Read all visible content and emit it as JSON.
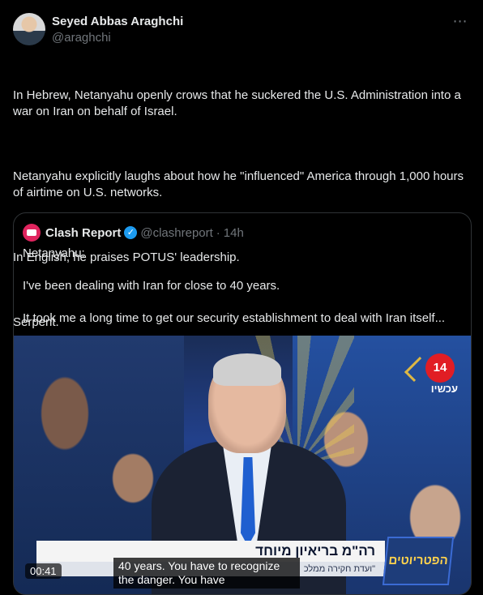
{
  "author": {
    "name": "Seyed Abbas Araghchi",
    "handle": "@araghchi",
    "more_icon": "more-icon"
  },
  "tweet": {
    "paragraphs": [
      "In Hebrew, Netanyahu openly crows that he suckered the U.S. Administration into a war on Iran on behalf of Israel.",
      "Netanyahu explicitly laughs about how he \"influenced\" America through 1,000 hours of airtime on U.S. networks.",
      "In English, he praises POTUS' leadership.",
      "Serpent."
    ]
  },
  "quoted": {
    "name": "Clash Report",
    "handle": "@clashreport",
    "separator": "·",
    "time": "14h",
    "verified_icon": "verified-icon",
    "paragraphs": [
      "Netanyahu:",
      "I've been dealing with Iran for close to 40 years.",
      "It took me a long time to get our security establishment to deal with Iran itself..."
    ],
    "video": {
      "channel_number": "14",
      "channel_sub": "עכשיו",
      "lower_title": "רה\"מ בריאיון מיוחד",
      "lower_sub": "\"ועדת חקירה ממלכ",
      "show_logo": "הפטריוטים",
      "caption": "40 years. You have to recognize the danger. You have",
      "timestamp": "00:41"
    }
  },
  "colors": {
    "background": "#000000",
    "text": "#e7e9ea",
    "secondary": "#71767b",
    "border": "#2f3336",
    "verified": "#1d9bf0"
  }
}
